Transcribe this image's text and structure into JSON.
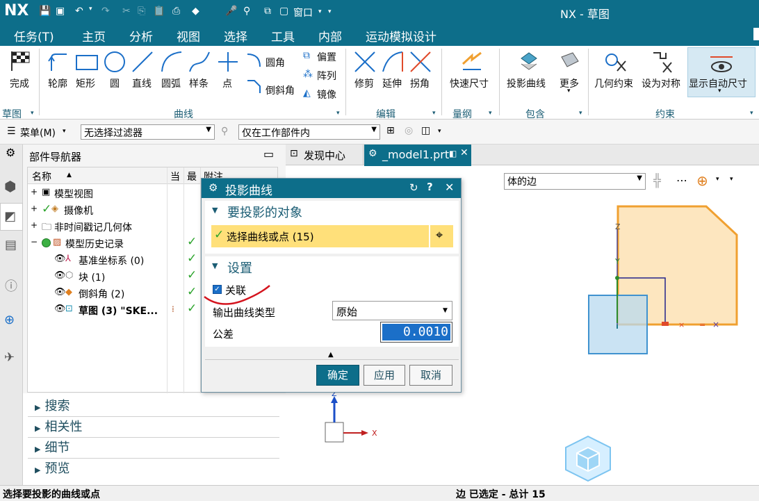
{
  "app": {
    "logo": "NX",
    "title": "NX - 草图"
  },
  "quick_access": {
    "window_label": "窗口"
  },
  "menu_tabs": [
    "任务(T)",
    "主页",
    "分析",
    "视图",
    "选择",
    "工具",
    "内部",
    "运动模拟设计"
  ],
  "ribbon": {
    "finish": "完成",
    "curve_tools": [
      "轮廓",
      "矩形",
      "圆",
      "直线",
      "圆弧",
      "样条",
      "点"
    ],
    "fillet": "圆角",
    "chamfer": "倒斜角",
    "offset": "偏置",
    "array": "阵列",
    "mirror": "镜像",
    "edit_tools": [
      "修剪",
      "延伸",
      "拐角"
    ],
    "quick_dim": "快速尺寸",
    "project_curve": "投影曲线",
    "more": "更多",
    "geo_constraint": "几何约束",
    "set_symmetric": "设为对称",
    "show_auto_dim": "显示自动尺寸",
    "groups": [
      "草图",
      "曲线",
      "编辑",
      "量纲",
      "包含",
      "约束"
    ]
  },
  "toolbar": {
    "menu": "菜单(M)",
    "filter_value": "无选择过滤器",
    "scope_value": "仅在工作部件内"
  },
  "navigator": {
    "title": "部件导航器",
    "columns": [
      "名称",
      "当",
      "最",
      "附注"
    ],
    "rows": [
      {
        "label": "模型视图",
        "check": ""
      },
      {
        "label": "摄像机",
        "check": ""
      },
      {
        "label": "非时间戳记几何体",
        "check": ""
      },
      {
        "label": "模型历史记录",
        "check": "✓"
      },
      {
        "label": "基准坐标系 (0)",
        "check": "✓"
      },
      {
        "label": "块 (1)",
        "check": "✓"
      },
      {
        "label": "倒斜角 (2)",
        "check": "✓"
      },
      {
        "label": "草图 (3) \"SKE...",
        "check": "✓"
      }
    ],
    "sections": [
      "搜索",
      "相关性",
      "细节",
      "预览"
    ]
  },
  "graphics": {
    "tabs": [
      "发现中心",
      "_model1.prt"
    ],
    "edge_filter": "体的边",
    "axis_z": "Z",
    "axis_x": "X",
    "axis_y": "Y"
  },
  "dialog": {
    "title": "投影曲线",
    "section1": "要投影的对象",
    "select_label": "选择曲线或点 (15)",
    "section2": "设置",
    "associative_label": "关联",
    "output_type_label": "输出曲线类型",
    "output_type_value": "原始",
    "tolerance_label": "公差",
    "tolerance_value": "0.0010",
    "ok": "确定",
    "apply": "应用",
    "cancel": "取消"
  },
  "status": {
    "prompt": "选择要投影的曲线或点",
    "selection": "边 已选定 - 总计 15"
  },
  "colors": {
    "brand": "#0d6e8a",
    "accent": "#1b6fc8",
    "highlight": "#ffe07a",
    "block_fill": "#fde6bf",
    "block_edge": "#f0a030"
  }
}
